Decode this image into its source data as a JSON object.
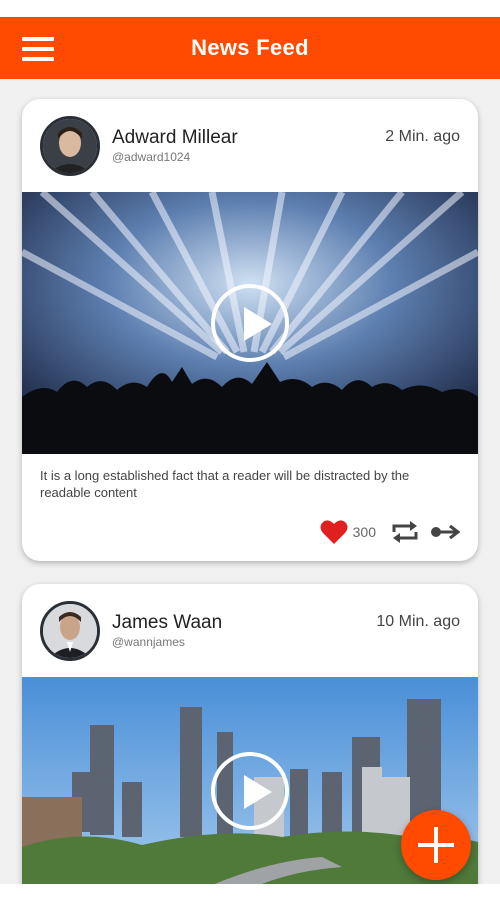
{
  "header": {
    "title": "News Feed",
    "menu_icon": "hamburger-menu-icon",
    "background_color": "#ff4a00"
  },
  "posts": [
    {
      "author_name": "Adward Millear",
      "author_handle": "@adward1024",
      "time": "2 Min. ago",
      "media_type": "video",
      "text": "It is a long established fact that a reader will be distracted by the readable content",
      "likes": "300",
      "like_icon": "heart-icon",
      "repost_icon": "repost-icon",
      "share_icon": "share-icon"
    },
    {
      "author_name": "James Waan",
      "author_handle": "@wannjames",
      "time": "10 Min. ago",
      "media_type": "video"
    }
  ],
  "fab": {
    "icon": "plus-icon",
    "color": "#ff4a00"
  }
}
